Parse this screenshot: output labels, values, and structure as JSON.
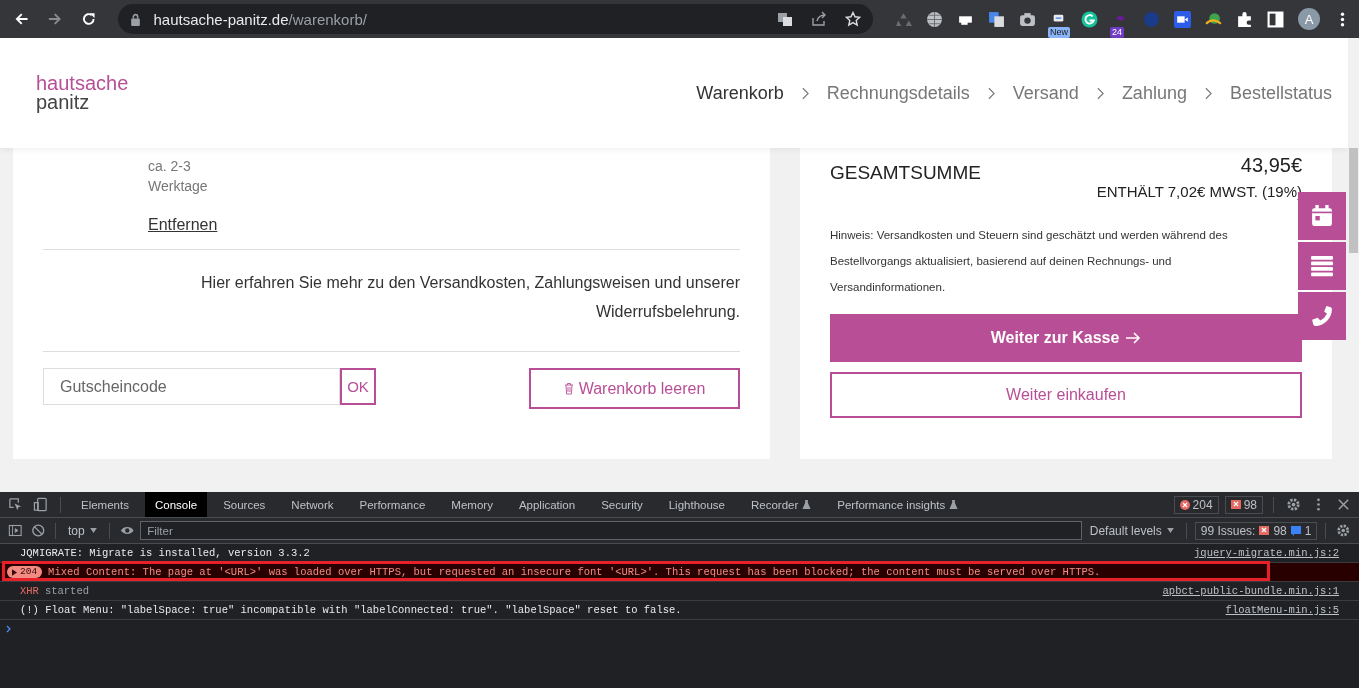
{
  "browser": {
    "url_host": "hautsache-panitz.de",
    "url_path": "/warenkorb/",
    "new_badge": "New",
    "count_badge": "24",
    "avatar": "A"
  },
  "site": {
    "logo_top": "hautsache",
    "logo_bottom": "panitz",
    "steps": [
      {
        "label": "Warenkorb",
        "selected": true
      },
      {
        "label": "Rechnungsdetails",
        "selected": false
      },
      {
        "label": "Versand",
        "selected": false
      },
      {
        "label": "Zahlung",
        "selected": false
      },
      {
        "label": "Bestellstatus",
        "selected": false
      }
    ]
  },
  "cart": {
    "delivery": [
      "ca. 2-3",
      "Werktage"
    ],
    "remove": "Entfernen",
    "info": "Hier erfahren Sie mehr zu den Versandkosten, Zahlungsweisen und unserer Widerrufsbelehrung.",
    "coupon_placeholder": "Gutscheincode",
    "coupon_ok": "OK",
    "clear": "Warenkorb leeren"
  },
  "summary": {
    "total_label": "GESAMTSUMME",
    "total": "43,95€",
    "tax": "ENTHÄLT 7,02€ MWST. (19%)",
    "note": "Hinweis: Versandkosten und Steuern sind geschätzt und werden während des Bestellvorgangs aktualisiert, basierend auf deinen Rechnungs- und Versandinformationen.",
    "checkout": "Weiter zur Kasse",
    "continue": "Weiter einkaufen"
  },
  "devtools": {
    "tabs": [
      {
        "label": "Elements",
        "selected": false,
        "experimental": false
      },
      {
        "label": "Console",
        "selected": true,
        "experimental": false
      },
      {
        "label": "Sources",
        "selected": false,
        "experimental": false
      },
      {
        "label": "Network",
        "selected": false,
        "experimental": false
      },
      {
        "label": "Performance",
        "selected": false,
        "experimental": false
      },
      {
        "label": "Memory",
        "selected": false,
        "experimental": false
      },
      {
        "label": "Application",
        "selected": false,
        "experimental": false
      },
      {
        "label": "Security",
        "selected": false,
        "experimental": false
      },
      {
        "label": "Lighthouse",
        "selected": false,
        "experimental": false
      },
      {
        "label": "Recorder",
        "selected": false,
        "experimental": true
      },
      {
        "label": "Performance insights",
        "selected": false,
        "experimental": true
      }
    ],
    "error_count": "204",
    "issue_count": "98",
    "context": "top",
    "filter_placeholder": "Filter",
    "levels": "Default levels",
    "issues_label": "99 Issues:",
    "issues_errors": "98",
    "issues_info": "1",
    "messages": [
      {
        "kind": "log",
        "text": "JQMIGRATE: Migrate is installed, version 3.3.2",
        "source": "jquery-migrate.min.js:2"
      },
      {
        "kind": "error",
        "count": "204",
        "text": "Mixed Content: The page at '<URL>' was loaded over HTTPS, but requested an insecure font '<URL>'. This request has been blocked; the content must be served over HTTPS.",
        "highlighted": true
      },
      {
        "kind": "xhr",
        "tag": "XHR",
        "text": "started",
        "source": "apbct-public-bundle.min.js:1"
      },
      {
        "kind": "log",
        "text": "(!) Float Menu: \"labelSpace: true\" incompatible with \"labelConnected: true\". \"labelSpace\" reset to false.",
        "source": "floatMenu-min.js:5"
      }
    ]
  }
}
